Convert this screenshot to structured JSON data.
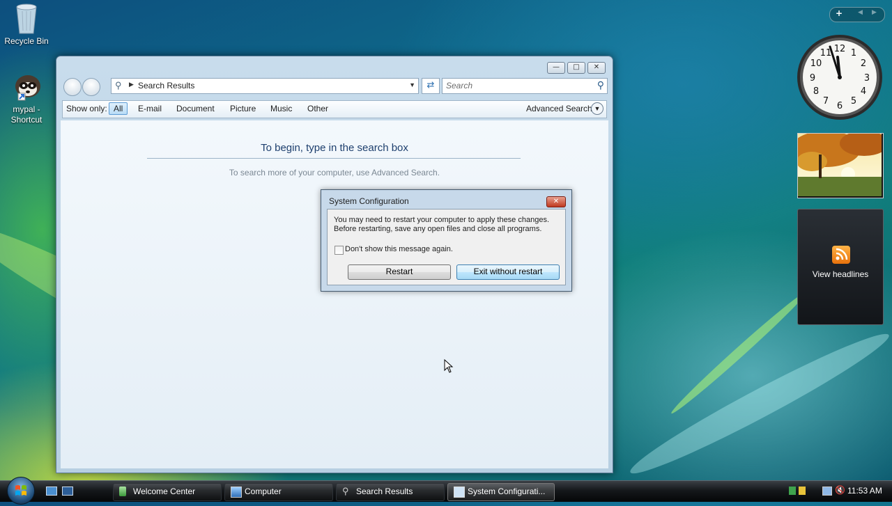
{
  "desktop": {
    "icons": [
      {
        "label": "Recycle Bin"
      },
      {
        "label": "mypal -\nShortcut"
      }
    ]
  },
  "explorer": {
    "address": "Search Results",
    "search_placeholder": "Search",
    "filter": {
      "show_only_label": "Show only:",
      "items": [
        "All",
        "E-mail",
        "Document",
        "Picture",
        "Music",
        "Other"
      ],
      "advanced": "Advanced Search"
    },
    "empty_title": "To begin, type in the search box",
    "empty_hint": "To search more of your computer, use Advanced Search."
  },
  "dialog": {
    "title": "System Configuration",
    "message_line1": "You may need to restart your computer to apply these changes.",
    "message_line2": "Before restarting, save any open files and close all programs.",
    "checkbox_label": "Don't show this message again.",
    "checkbox_checked": false,
    "restart": "Restart",
    "exit": "Exit without restart"
  },
  "gadgets": {
    "clock_numbers": [
      "12",
      "1",
      "2",
      "3",
      "4",
      "5",
      "6",
      "7",
      "8",
      "9",
      "10",
      "11"
    ],
    "feed_label": "View headlines"
  },
  "taskbar": {
    "buttons": [
      {
        "label": "Welcome Center"
      },
      {
        "label": "Computer"
      },
      {
        "label": "Search Results"
      },
      {
        "label": "System Configurati..."
      }
    ],
    "time": "11:53 AM"
  }
}
